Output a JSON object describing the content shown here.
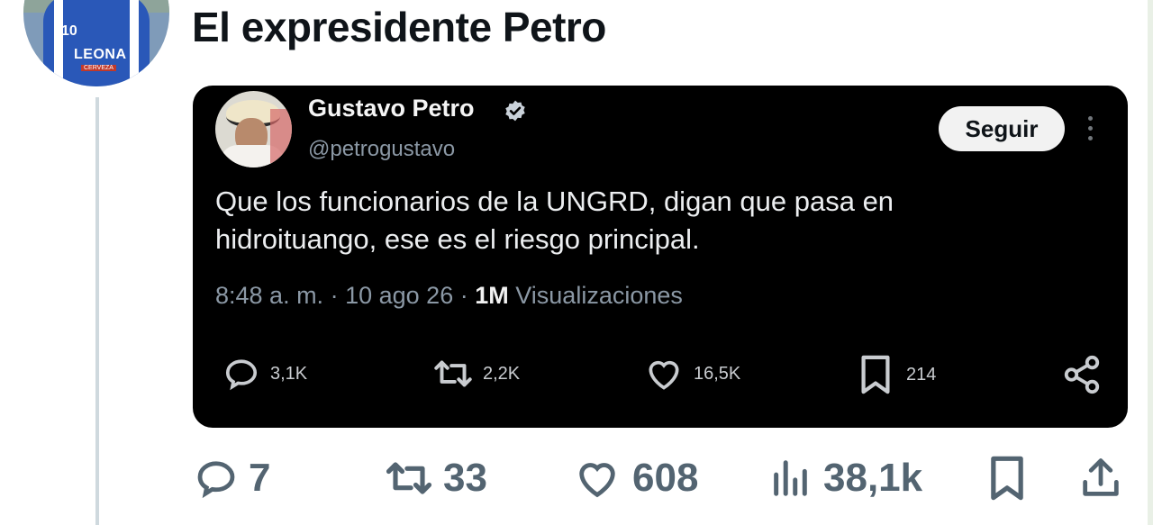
{
  "post": {
    "title": "El expresidente Petro"
  },
  "quoted": {
    "author_name": "Gustavo Petro",
    "handle": "@petrogustavo",
    "follow_label": "Seguir",
    "text": "Que los funcionarios de la UNGRD, digan que pasa en hidroituango, ese es el riesgo principal.",
    "time": "8:48 a. m.",
    "date": "10 ago 26",
    "views_value": "1M",
    "views_label": "Visualizaciones",
    "replies": "3,1K",
    "reposts": "2,2K",
    "likes": "16,5K",
    "bookmarks": "214"
  },
  "actions": {
    "replies": "7",
    "reposts": "33",
    "likes": "608",
    "views": "38,1k"
  },
  "icons": {
    "avatar": "user-avatar",
    "reply": "reply-icon",
    "repost": "repost-icon",
    "like": "heart-icon",
    "bookmark": "bookmark-icon",
    "views": "views-icon",
    "share": "share-icon",
    "verified": "verified-badge-icon",
    "more": "more-icon"
  },
  "colors": {
    "accent": "#1d9bf0",
    "icon_gray": "#536471",
    "card_bg": "#000000"
  }
}
